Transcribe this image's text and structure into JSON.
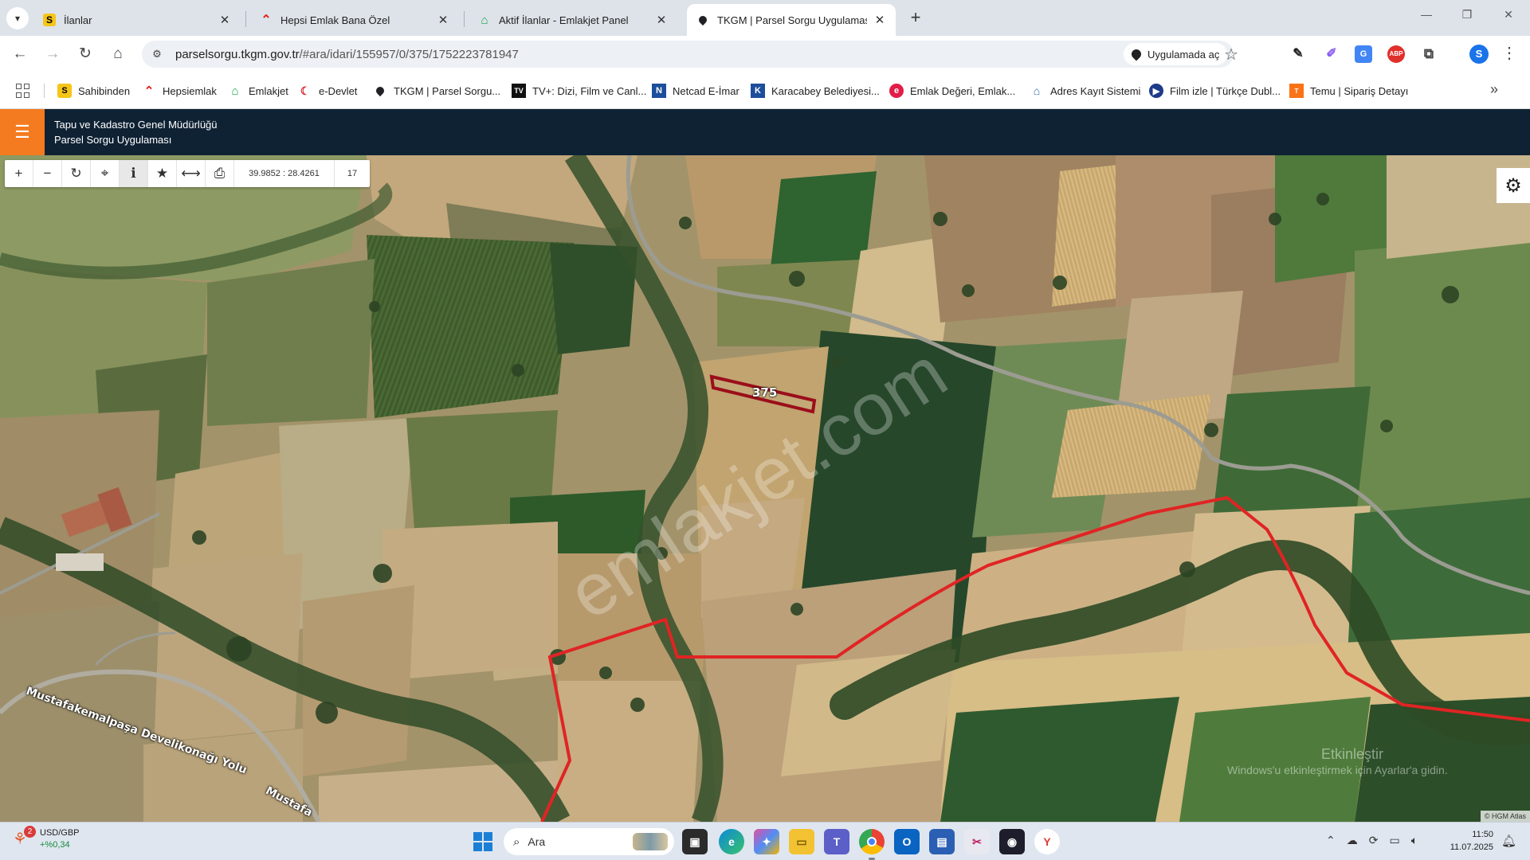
{
  "browser": {
    "tabs": [
      {
        "title": "İlanlar",
        "icon": "sahibinden-favicon",
        "color": "#f5c518"
      },
      {
        "title": "Hepsi Emlak Bana Özel",
        "icon": "hepsiemlak-favicon",
        "color": "#e1251b"
      },
      {
        "title": "Aktif İlanlar - Emlakjet Panel",
        "icon": "emlakjet-favicon",
        "color": "#17a34a"
      },
      {
        "title": "TKGM | Parsel Sorgu Uygulaması",
        "icon": "location-pin-icon",
        "color": "#202124"
      }
    ],
    "url_host": "parselsorgu.tkgm.gov.tr",
    "url_path": "/#ara/idari/155957/0/375/1752223781947",
    "open_in_app_label": "Uygulamada aç",
    "profile_initial": "S",
    "bookmarks": [
      {
        "label": "Sahibinden",
        "icon": "sahibinden-favicon"
      },
      {
        "label": "Hepsiemlak",
        "icon": "hepsiemlak-favicon"
      },
      {
        "label": "Emlakjet",
        "icon": "emlakjet-favicon"
      },
      {
        "label": "e-Devlet",
        "icon": "edevlet-favicon"
      },
      {
        "label": "TKGM | Parsel Sorgu...",
        "icon": "location-pin-icon"
      },
      {
        "label": "TV+: Dizi, Film ve Canl...",
        "icon": "tvplus-favicon"
      },
      {
        "label": "Netcad E-İmar",
        "icon": "netcad-favicon"
      },
      {
        "label": "Karacabey Belediyesi...",
        "icon": "karacabey-favicon"
      },
      {
        "label": "Emlak Değeri, Emlak...",
        "icon": "emlak-degeri-favicon"
      },
      {
        "label": "Adres Kayıt Sistemi",
        "icon": "adres-favicon"
      },
      {
        "label": "Film izle | Türkçe Dubl...",
        "icon": "film-favicon"
      },
      {
        "label": "Temu | Sipariş Detayı",
        "icon": "temu-favicon"
      }
    ]
  },
  "app": {
    "title_line1": "Tapu ve Kadastro Genel Müdürlüğü",
    "title_line2": "Parsel Sorgu Uygulaması",
    "accent": "#f47b20",
    "header_bg": "#0f2234"
  },
  "map": {
    "coordinates": "39.9852 : 28.4261",
    "zoom": "17",
    "parcel_number": "375",
    "watermark": "emlakjet.com",
    "road_label_1": "Mustafakemalpaşa Develikonağı Yolu",
    "road_label_2": "Mustafa",
    "attribution": "© HGM Atlas",
    "activation_line1": "Etkinleştir",
    "activation_line2": "Windows'u etkinleştirmek için Ayarlar'a gidin.",
    "boundary_color": "#e02424"
  },
  "taskbar": {
    "widget_badge": "2",
    "widget_title": "USD/GBP",
    "widget_change": "+%0,34",
    "search_placeholder": "Ara",
    "time": "11:50",
    "date": "11.07.2025"
  }
}
